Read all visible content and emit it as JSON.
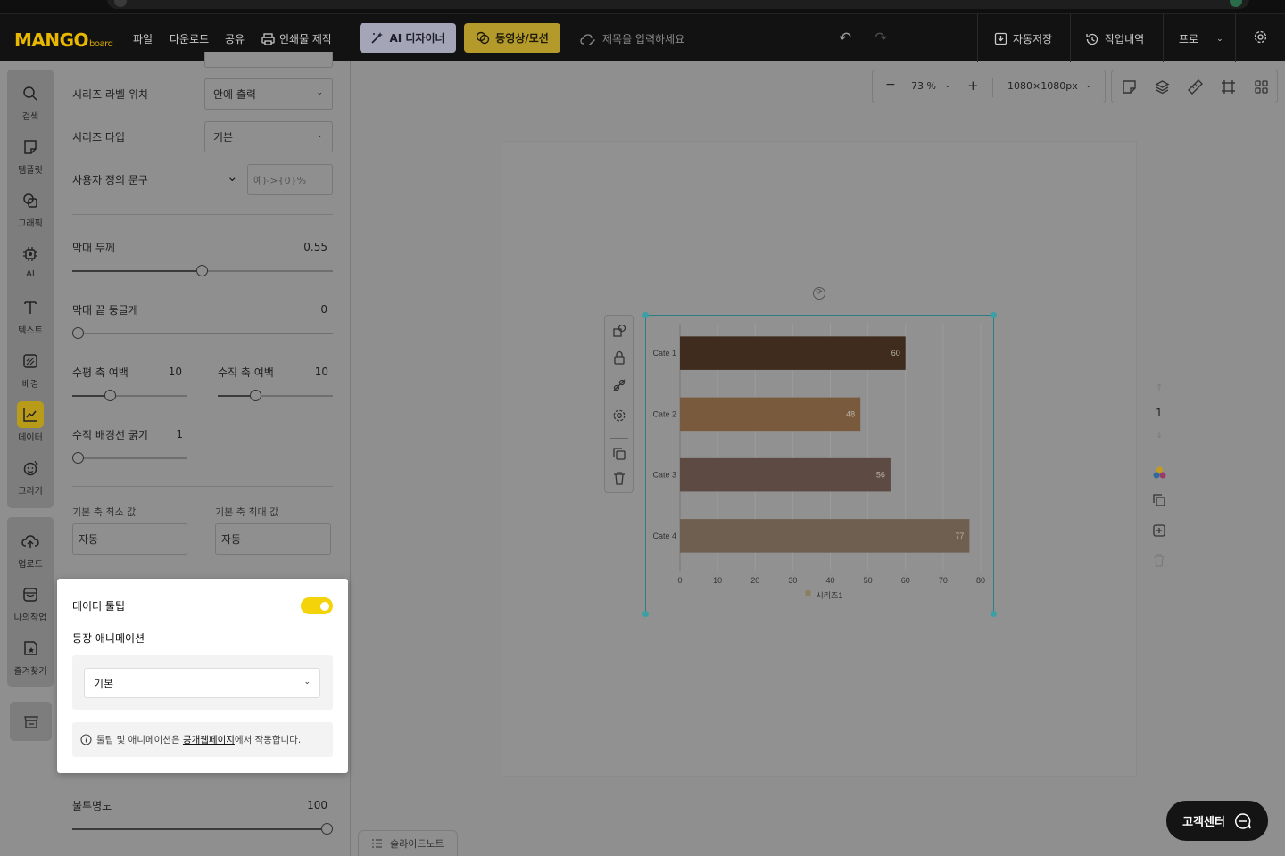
{
  "topbar": {
    "logo": "MANGO",
    "logo_sub": "board",
    "menu": [
      "파일",
      "다운로드",
      "공유",
      "인쇄물 제작"
    ],
    "ai_designer": "AI 디자이너",
    "video_motion": "동영상/모션",
    "title_placeholder": "제목을 입력하세요",
    "autosave": "자동저장",
    "history": "작업내역",
    "plan": "프로"
  },
  "leftnav": {
    "items": [
      "검색",
      "템플릿",
      "그래픽",
      "AI",
      "텍스트",
      "배경",
      "데이터",
      "그리기"
    ],
    "items2": [
      "업로드",
      "나의작업",
      "즐겨찾기"
    ],
    "active": "데이터",
    "accent": "#b99b1a"
  },
  "panel": {
    "series_label_pos": {
      "label": "시리즈 라벨 위치",
      "value": "안에 출력"
    },
    "series_type": {
      "label": "시리즈 타입",
      "value": "기본"
    },
    "custom_text": {
      "label": "사용자 정의 문구",
      "placeholder": "예)->{0}%"
    },
    "bar_thickness": {
      "label": "막대 두께",
      "value": "0.55",
      "fraction": 0.55
    },
    "bar_round": {
      "label": "막대 끝 둥글게",
      "value": "0",
      "fraction": 0
    },
    "h_margin": {
      "label": "수평 축 여백",
      "value": "10",
      "fraction": 0.33
    },
    "v_margin": {
      "label": "수직 축 여백",
      "value": "10",
      "fraction": 0.33
    },
    "v_grid": {
      "label": "수직 배경선 굵기",
      "value": "1",
      "fraction": 0
    },
    "axis_min": {
      "label": "기본 축 최소 값",
      "value": "자동"
    },
    "axis_max": {
      "label": "기본 축 최대 값",
      "value": "자동"
    },
    "range_sep": "-",
    "opacity": {
      "label": "불투명도",
      "value": "100",
      "fraction": 1
    }
  },
  "popup": {
    "tooltip_label": "데이터 툴팁",
    "tooltip_on": true,
    "animation_label": "등장 애니메이션",
    "animation_value": "기본",
    "note_prefix": "툴팁 및 애니메이션은 ",
    "note_link": "공개웹페이지",
    "note_suffix": "에서 작동합니다.",
    "toggle_color": "#f5d30a"
  },
  "canvas": {
    "zoom": "73 %",
    "size": "1080×1080px",
    "page_number": "1",
    "slide_note": "슬라이드노트",
    "support": "고객센터"
  },
  "chart_data": {
    "type": "bar",
    "orientation": "horizontal",
    "categories": [
      "Cate 1",
      "Cate 2",
      "Cate 3",
      "Cate 4"
    ],
    "series": [
      {
        "name": "시리즈1",
        "values": [
          60,
          48,
          56,
          77
        ]
      }
    ],
    "bar_colors": [
      "#3f2c1e",
      "#7a5a3c",
      "#5c4a43",
      "#6e5f50"
    ],
    "xlim": [
      0,
      80
    ],
    "xticks": [
      "0",
      "10",
      "20",
      "30",
      "40",
      "50",
      "60",
      "70",
      "80"
    ],
    "grid": true,
    "legend": "bottom",
    "legend_color": "#8a8060"
  }
}
